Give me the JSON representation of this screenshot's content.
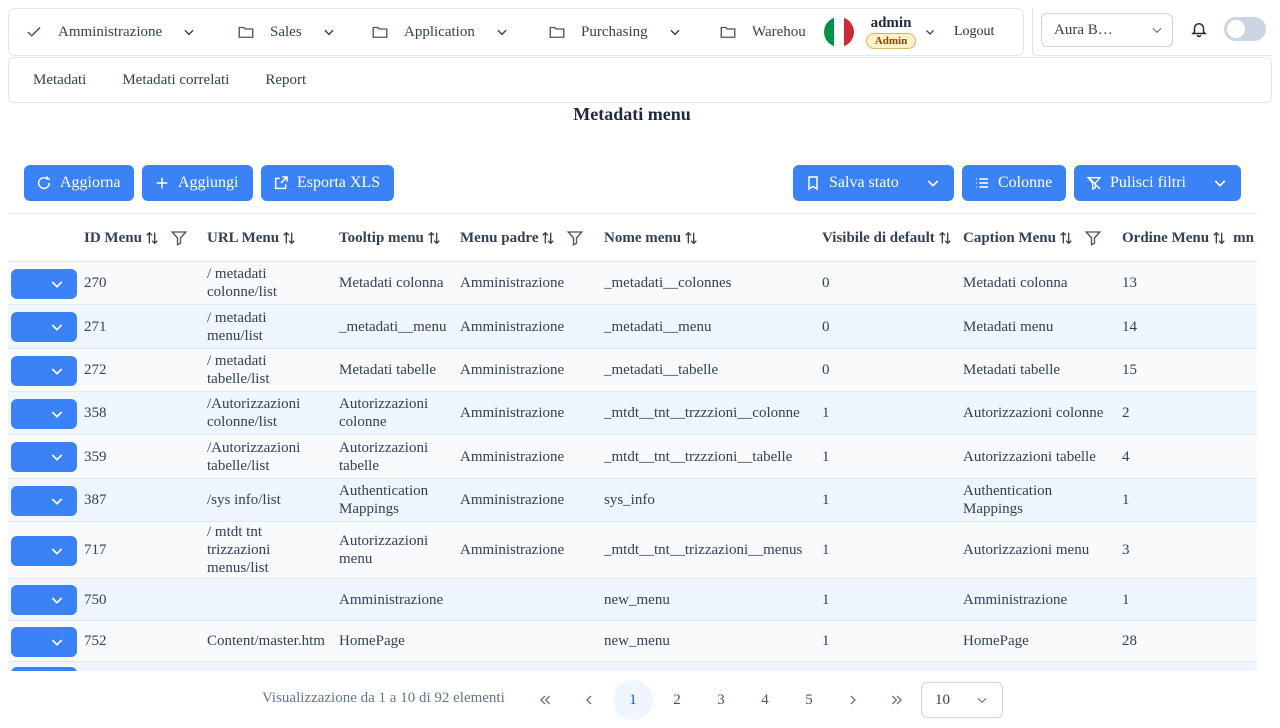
{
  "nav": {
    "items": [
      {
        "label": "Amministrazione",
        "icon": "check-icon"
      },
      {
        "label": "Sales",
        "icon": "folder-icon"
      },
      {
        "label": "Application",
        "icon": "folder-icon"
      },
      {
        "label": "Purchasing",
        "icon": "folder-icon"
      },
      {
        "label": "Warehou",
        "icon": "folder-icon"
      }
    ],
    "flag_colors": [
      "#009246",
      "#ffffff",
      "#ce2b37"
    ],
    "user": {
      "name": "admin",
      "role": "Admin"
    },
    "logout": "Logout"
  },
  "right_panel": {
    "tenant_value": "Aura B…",
    "bell_icon": "bell-icon",
    "toggle_on": false
  },
  "subnav": [
    "Metadati",
    "Metadati correlati",
    "Report"
  ],
  "page_title": "Metadati menu",
  "toolbar": {
    "refresh": "Aggiorna",
    "add": "Aggiungi",
    "export": "Esporta XLS",
    "save_state": "Salva stato",
    "columns": "Colonne",
    "clear_filters": "Pulisci filtri",
    "accent": "#3b82f6"
  },
  "table": {
    "headers": {
      "id": "ID Menu",
      "url": "URL Menu",
      "tooltip": "Tooltip menu",
      "parent": "Menu padre",
      "name": "Nome menu",
      "visible": "Visibile di default",
      "caption": "Caption Menu",
      "order": "Ordine Menu",
      "extra": "mn"
    },
    "rows": [
      {
        "id": "270",
        "url": [
          "/ metadati",
          "colonne/list"
        ],
        "tooltip": [
          "Metadati colonna"
        ],
        "parent": "Amministrazione",
        "name": "_metadati__colonnes",
        "visible": "0",
        "caption": [
          "Metadati colonna"
        ],
        "order": "13"
      },
      {
        "id": "271",
        "url": [
          "/ metadati",
          "menu/list"
        ],
        "tooltip": [
          "_metadati__menu"
        ],
        "parent": "Amministrazione",
        "name": "_metadati__menu",
        "visible": "0",
        "caption": [
          "Metadati menu"
        ],
        "order": "14"
      },
      {
        "id": "272",
        "url": [
          "/ metadati",
          "tabelle/list"
        ],
        "tooltip": [
          "Metadati tabelle"
        ],
        "parent": "Amministrazione",
        "name": "_metadati__tabelle",
        "visible": "0",
        "caption": [
          "Metadati tabelle"
        ],
        "order": "15"
      },
      {
        "id": "358",
        "url": [
          "/Autorizzazioni",
          "colonne/list"
        ],
        "tooltip": [
          "Autorizzazioni",
          "colonne"
        ],
        "parent": "Amministrazione",
        "name": "_mtdt__tnt__trzzzioni__colonne",
        "visible": "1",
        "caption": [
          "Autorizzazioni colonne"
        ],
        "order": "2"
      },
      {
        "id": "359",
        "url": [
          "/Autorizzazioni",
          "tabelle/list"
        ],
        "tooltip": [
          "Autorizzazioni",
          "tabelle"
        ],
        "parent": "Amministrazione",
        "name": "_mtdt__tnt__trzzzioni__tabelle",
        "visible": "1",
        "caption": [
          "Autorizzazioni tabelle"
        ],
        "order": "4"
      },
      {
        "id": "387",
        "url": [
          "/sys info/list"
        ],
        "tooltip": [
          "Authentication",
          "Mappings"
        ],
        "parent": "Amministrazione",
        "name": "sys_info",
        "visible": "1",
        "caption": [
          "Authentication",
          "Mappings"
        ],
        "order": "1"
      },
      {
        "id": "717",
        "url": [
          "/ mtdt tnt",
          "trizzazioni",
          "menus/list"
        ],
        "tooltip": [
          "Autorizzazioni",
          "menu"
        ],
        "parent": "Amministrazione",
        "name": "_mtdt__tnt__trizzazioni__menus",
        "visible": "1",
        "caption": [
          "Autorizzazioni menu"
        ],
        "order": "3"
      },
      {
        "id": "750",
        "url": [],
        "tooltip": [
          "Amministrazione"
        ],
        "parent": "",
        "name": "new_menu",
        "visible": "1",
        "caption": [
          "Amministrazione"
        ],
        "order": "1"
      },
      {
        "id": "752",
        "url": [
          "Content/master.htm"
        ],
        "tooltip": [
          "HomePage"
        ],
        "parent": "",
        "name": "new_menu",
        "visible": "1",
        "caption": [
          "HomePage"
        ],
        "order": "28"
      }
    ]
  },
  "pagination": {
    "info": "Visualizzazione da 1 a 10 di 92 elementi",
    "pages": [
      "1",
      "2",
      "3",
      "4",
      "5"
    ],
    "current": "1",
    "rows_per_page": "10"
  }
}
